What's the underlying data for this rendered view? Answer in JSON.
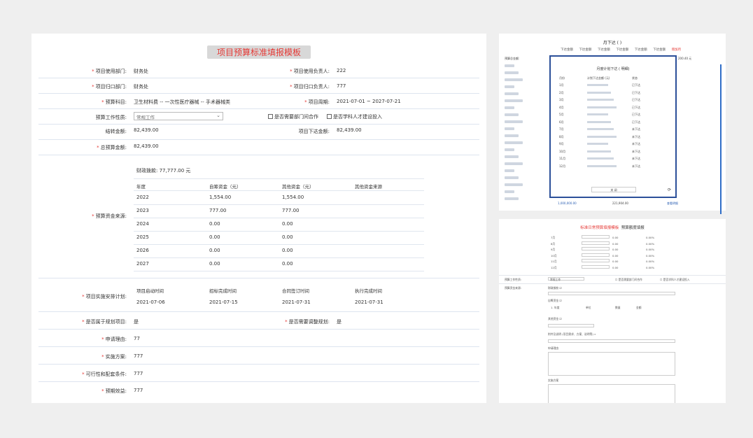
{
  "main": {
    "title": "项目预算标准填报模板",
    "dept_label": "项目使用部门:",
    "dept_value": "财务处",
    "owner_label": "项目使用负责人:",
    "owner_value": "222",
    "gate_dept_label": "项目归口部门:",
    "gate_dept_value": "财务处",
    "gate_owner_label": "项目归口负责人:",
    "gate_owner_value": "777",
    "subject_label": "预算科目:",
    "subject_value": "卫生材料费 -- 一次性医疗器械 -- 手术器械类",
    "period_label": "项目周期:",
    "period_value": "2021-07-01 ~ 2027-07-21",
    "work_nature_label": "预算工作性质:",
    "work_nature_value": "常规工作",
    "cross_dept_label": "是否需要部门间合作",
    "talent_label": "是否学科人才建设投入",
    "carry_label": "结转金额:",
    "carry_value": "82,439.00",
    "issued_label": "项目下达金额:",
    "issued_value": "82,439.00",
    "total_label": "总预算金额:",
    "total_value": "82,439.00",
    "fund_source_label": "预算资金来源:",
    "fiscal_label": "财政拨款: 77,777.00 元",
    "fund_headers": [
      "年度",
      "自筹资金（元）",
      "其他资金（元）",
      "其他资金来源"
    ],
    "fund_rows": [
      [
        "2022",
        "1,554.00",
        "1,554.00"
      ],
      [
        "2023",
        "777.00",
        "777.00"
      ],
      [
        "2024",
        "0.00",
        "0.00"
      ],
      [
        "2025",
        "0.00",
        "0.00"
      ],
      [
        "2026",
        "0.00",
        "0.00"
      ],
      [
        "2027",
        "0.00",
        "0.00"
      ]
    ],
    "plan_label": "项目实施安排计划:",
    "plan_headers": [
      "项目启动时间",
      "招标完成时间",
      "合同签订时间",
      "执行完成时间"
    ],
    "plan_values": [
      "2021-07-06",
      "2021-07-15",
      "2021-07-31",
      "2021-07-31"
    ],
    "planned_label": "是否属于规划项目:",
    "planned_value": "是",
    "adjust_label": "是否需要调整规划:",
    "adjust_value": "是",
    "reason_label": "申请理由:",
    "reason_value": "77",
    "scheme_label": "实施方案:",
    "scheme_value": "777",
    "feasibility_label": "可行性和配套条件:",
    "feasibility_value": "777",
    "benefit_label": "预期效益:",
    "benefit_value": "777"
  },
  "top_right": {
    "title": "月下达 (            )",
    "tabs": [
      "下达金额",
      "下达金额",
      "下达金额",
      "下达金额",
      "下达金额",
      "下达金额",
      "增加月"
    ],
    "left_label": "预算总金额:",
    "right_value": "200.40 元",
    "modal_title": "月度计划下达 (          明细)",
    "modal_headers": [
      "月份",
      "计划下达金额 (元)",
      "状态"
    ],
    "modal_rows": [
      [
        "1月",
        "已下达"
      ],
      [
        "2月",
        "已下达"
      ],
      [
        "3月",
        "已下达"
      ],
      [
        "4月",
        "已下达"
      ],
      [
        "5月",
        "已下达"
      ],
      [
        "6月",
        "已下达"
      ],
      [
        "7月",
        "未下达"
      ],
      [
        "8月",
        "未下达"
      ],
      [
        "9月",
        "未下达"
      ],
      [
        "10月",
        "未下达"
      ],
      [
        "11月",
        "未下达"
      ],
      [
        "12月",
        "未下达"
      ]
    ],
    "modal_button": "关 闭",
    "footer_left": "1,000,000.00",
    "footer_mid": "221,904.00",
    "footer_right": "查看明细"
  },
  "bottom_right": {
    "title_red": "标准日常预算填报模板",
    "title_black": "预算额度填报",
    "rows": [
      [
        "7月",
        "0.00",
        "0.00%"
      ],
      [
        "8月",
        "0.00",
        "0.00%"
      ],
      [
        "9月",
        "0.00",
        "0.00%"
      ],
      [
        "10月",
        "0.00",
        "0.00%"
      ],
      [
        "11月",
        "0.00",
        "0.00%"
      ],
      [
        "12月",
        "0.00",
        "0.00%"
      ]
    ],
    "nature_label": "预算工作性质:",
    "nature_value": "常规工作",
    "cb1": "是否需要部门间合作",
    "cb2": "是否学科人才建设投入",
    "fund_label": "预算资金来源:",
    "fiscal": "财政拨款",
    "self": "自筹资金",
    "cols": [
      "1. 年度",
      "单位",
      "数量",
      "金额"
    ],
    "other": "其他资金",
    "attach_label": "附件及说明 (项目需求、方案、说明等)",
    "reason": "申请理由",
    "scheme": "实施方案"
  },
  "colors": {
    "accent_red": "#e53935",
    "dialog_border": "#2b4f99",
    "scroll_blue": "#2f6dc7"
  }
}
